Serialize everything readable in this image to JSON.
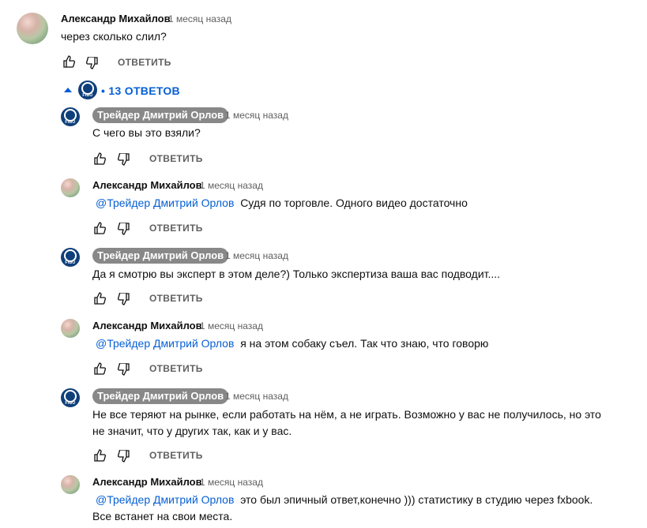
{
  "top": {
    "author": "Александр Михайлов",
    "time": "1 месяц назад",
    "text": "через сколько слил?",
    "reply_label": "ОТВЕТИТЬ",
    "replies_toggle": "• 13 ОТВЕТОВ"
  },
  "replies": [
    {
      "author": "Трейдер Дмитрий Орлов",
      "time": "1 месяц назад",
      "mention": "",
      "text": "С чего вы это взяли?",
      "text2": "",
      "reply_label": "ОТВЕТИТЬ"
    },
    {
      "author": "Александр Михайлов",
      "time": "1 месяц назад",
      "mention": "@Трейдер Дмитрий Орлов",
      "text": "Судя по торговле. Одного видео достаточно",
      "text2": "",
      "reply_label": "ОТВЕТИТЬ"
    },
    {
      "author": "Трейдер Дмитрий Орлов",
      "time": "1 месяц назад",
      "mention": "",
      "text": "Да я смотрю вы эксперт в этом деле?) Только экспертиза ваша вас подводит....",
      "text2": "",
      "reply_label": "ОТВЕТИТЬ"
    },
    {
      "author": "Александр Михайлов",
      "time": "1 месяц назад",
      "mention": "@Трейдер Дмитрий Орлов",
      "text": "я на этом собаку съел. Так что знаю, что говорю",
      "text2": "",
      "reply_label": "ОТВЕТИТЬ"
    },
    {
      "author": "Трейдер Дмитрий Орлов",
      "time": "1 месяц назад",
      "mention": "",
      "text": "Не все теряют на рынке, если работать на нём, а не играть. Возможно у вас не получилось, но это",
      "text2": "не значит, что у других так, как и у вас.",
      "reply_label": "ОТВЕТИТЬ"
    },
    {
      "author": "Александр Михайлов",
      "time": "1 месяц назад",
      "mention": "@Трейдер Дмитрий Орлов",
      "text": "это был эпичный ответ,конечно ))) статистику в студию через fxbook.",
      "text2": "Все встанет на свои места.",
      "reply_label": ""
    }
  ],
  "avatar_fibo_text": "FIBO",
  "colors": {
    "link": "#065fd4",
    "chip": "#888888",
    "meta": "#606060"
  }
}
